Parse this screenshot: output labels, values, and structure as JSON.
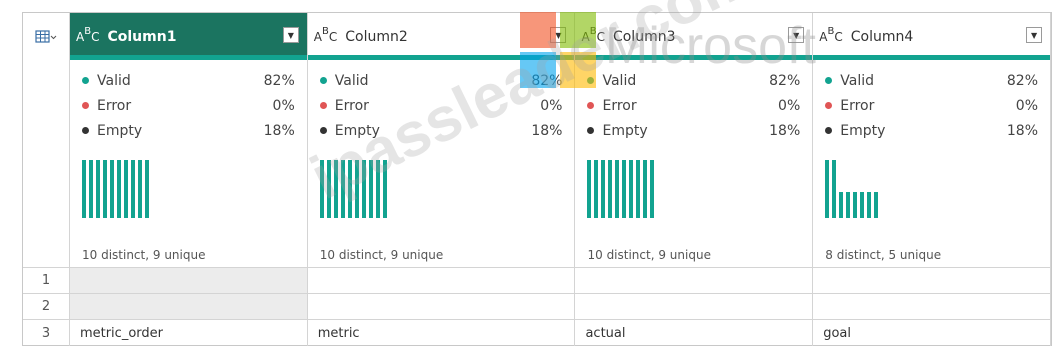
{
  "columns": [
    {
      "name": "Column1",
      "type_icon": "ABC",
      "selected": true,
      "valid": "82%",
      "error": "0%",
      "empty": "18%",
      "distinct": "10 distinct, 9 unique",
      "histogram": [
        1,
        1,
        1,
        1,
        1,
        1,
        1,
        1,
        1,
        1
      ]
    },
    {
      "name": "Column2",
      "type_icon": "ABC",
      "selected": false,
      "valid": "82%",
      "error": "0%",
      "empty": "18%",
      "distinct": "10 distinct, 9 unique",
      "histogram": [
        1,
        1,
        1,
        1,
        1,
        1,
        1,
        1,
        1,
        1
      ]
    },
    {
      "name": "Column3",
      "type_icon": "ABC",
      "selected": false,
      "valid": "82%",
      "error": "0%",
      "empty": "18%",
      "distinct": "10 distinct, 9 unique",
      "histogram": [
        1,
        1,
        1,
        1,
        1,
        1,
        1,
        1,
        1,
        1
      ]
    },
    {
      "name": "Column4",
      "type_icon": "ABC",
      "selected": false,
      "valid": "82%",
      "error": "0%",
      "empty": "18%",
      "distinct": "8 distinct, 5 unique",
      "histogram": [
        1,
        1,
        0.45,
        0.45,
        0.45,
        0.45,
        0.45,
        0.45
      ]
    }
  ],
  "labels": {
    "valid": "Valid",
    "error": "Error",
    "empty": "Empty"
  },
  "rows": [
    {
      "num": "1",
      "cells": [
        "",
        "",
        "",
        ""
      ]
    },
    {
      "num": "2",
      "cells": [
        "",
        "",
        "",
        ""
      ]
    },
    {
      "num": "3",
      "cells": [
        "metric_order",
        "metric",
        "actual",
        "goal"
      ]
    }
  ],
  "colors": {
    "selected_header": "#1b7460",
    "accent": "#12a390",
    "error_dot": "#e05555"
  },
  "watermark": {
    "site": "ipassleader.com",
    "brand": "Microsoft"
  }
}
